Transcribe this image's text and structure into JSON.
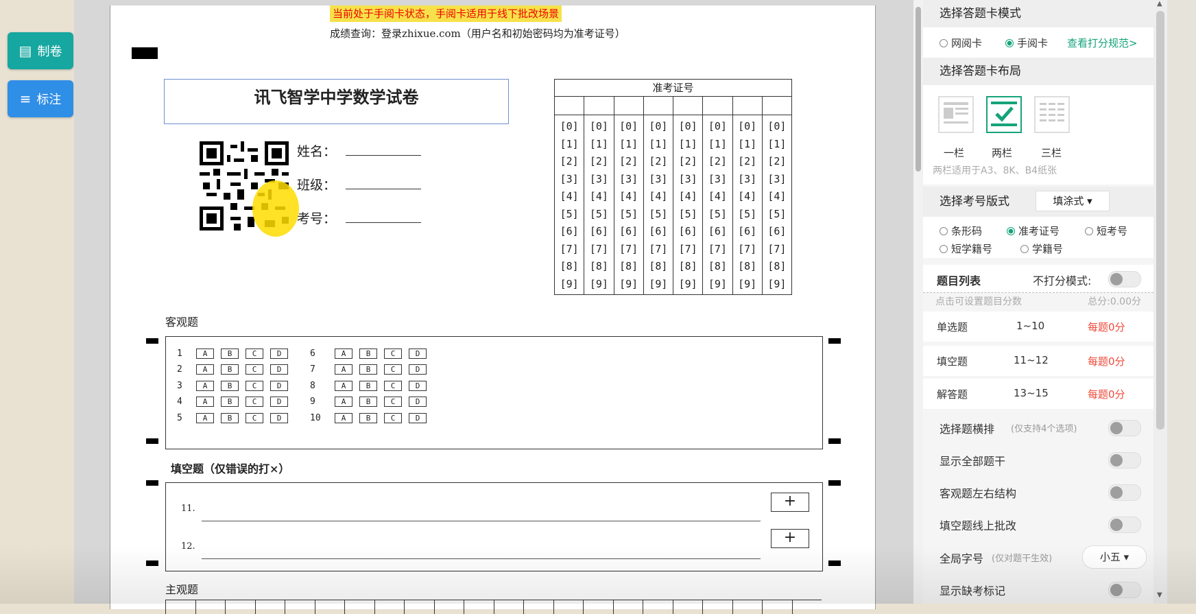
{
  "left_buttons": [
    {
      "label": "制卷",
      "icon": "document-icon"
    },
    {
      "label": "标注",
      "icon": "list-icon"
    }
  ],
  "paper": {
    "notice": "当前处于手阅卡状态，手阅卡适用于线下批改场景",
    "query": "成绩查询：登录zhixue.com（用户名和初始密码均为准考证号）",
    "title": "讯飞智学中学数学试卷",
    "name_label": "姓名：",
    "class_label": "班级：",
    "number_label": "考号：",
    "admission_title": "准考证号",
    "digits": [
      "[0]",
      "[1]",
      "[2]",
      "[3]",
      "[4]",
      "[5]",
      "[6]",
      "[7]",
      "[8]",
      "[9]"
    ],
    "objective_title": "客观题",
    "options": [
      "A",
      "B",
      "C",
      "D"
    ],
    "objective_numbers": [
      "1",
      "2",
      "3",
      "4",
      "5",
      "6",
      "7",
      "8",
      "9",
      "10"
    ],
    "fill_title": "填空题（仅错误的打×）",
    "fill_items": [
      "11.",
      "12."
    ],
    "plus": "+",
    "subjective_title": "主观题"
  },
  "panel": {
    "mode_title": "选择答题卡模式",
    "mode_options": [
      "网阅卡",
      "手阅卡"
    ],
    "mode_selected": "手阅卡",
    "scoring_link": "查看打分规范>",
    "layout_title": "选择答题卡布局",
    "layout_options": [
      "一栏",
      "两栏",
      "三栏"
    ],
    "layout_selected": "两栏",
    "layout_hint": "两栏适用于A3、8K、B4纸张",
    "exam_no_title": "选择考号版式",
    "exam_no_format": "填涂式",
    "exam_no_options": [
      "条形码",
      "准考证号",
      "短考号",
      "短学籍号",
      "学籍号"
    ],
    "exam_no_selected": "准考证号",
    "question_list_title": "题目列表",
    "no_score_mode": "不打分模式:",
    "score_hint": "点击可设置题目分数",
    "total_score": "总分:0.00分",
    "question_rows": [
      {
        "type": "单选题",
        "range": "1~10",
        "score": "每题0分"
      },
      {
        "type": "填空题",
        "range": "11~12",
        "score": "每题0分"
      },
      {
        "type": "解答题",
        "range": "13~15",
        "score": "每题0分"
      }
    ],
    "toggles": [
      {
        "label": "选择题横排",
        "note": "(仅支持4个选项)"
      },
      {
        "label": "显示全部题干",
        "note": ""
      },
      {
        "label": "客观题左右结构",
        "note": ""
      },
      {
        "label": "填空题线上批改",
        "note": ""
      }
    ],
    "font_size_label": "全局字号",
    "font_size_note": "(仅对题干生效)",
    "font_size_value": "小五",
    "absent_mark": "显示缺考标记"
  },
  "colors": {
    "teal": "#16a7a0",
    "blue": "#2f8ee6",
    "green": "#16a37a",
    "red": "#f04a3a",
    "notice_bg": "#f7e14a"
  }
}
